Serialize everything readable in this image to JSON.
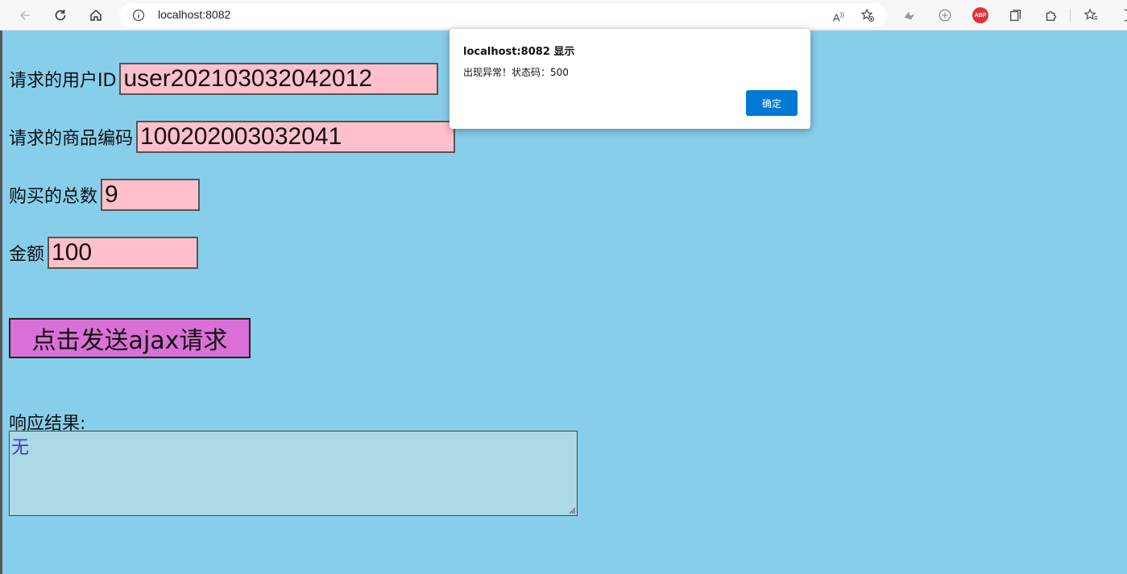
{
  "browser": {
    "url": "localhost:8082",
    "abp_label": "ABP"
  },
  "form": {
    "user_label": "请求的用户ID",
    "user_value": "user202103032042012",
    "product_label": "请求的商品编码",
    "product_value": "100202003032041",
    "quantity_label": "购买的总数",
    "quantity_value": "9",
    "amount_label": "金额",
    "amount_value": "100",
    "send_button": "点击发送ajax请求",
    "response_label": "响应结果:",
    "response_value": "无"
  },
  "dialog": {
    "title": "localhost:8082 显示",
    "message": "出现异常！状态码：500",
    "ok_label": "确定"
  },
  "colors": {
    "page_background": "#87ceeb",
    "input_background": "#ffc0cb",
    "button_background": "#da70d6",
    "response_background": "#add8e6",
    "dialog_ok": "#0078d4"
  }
}
